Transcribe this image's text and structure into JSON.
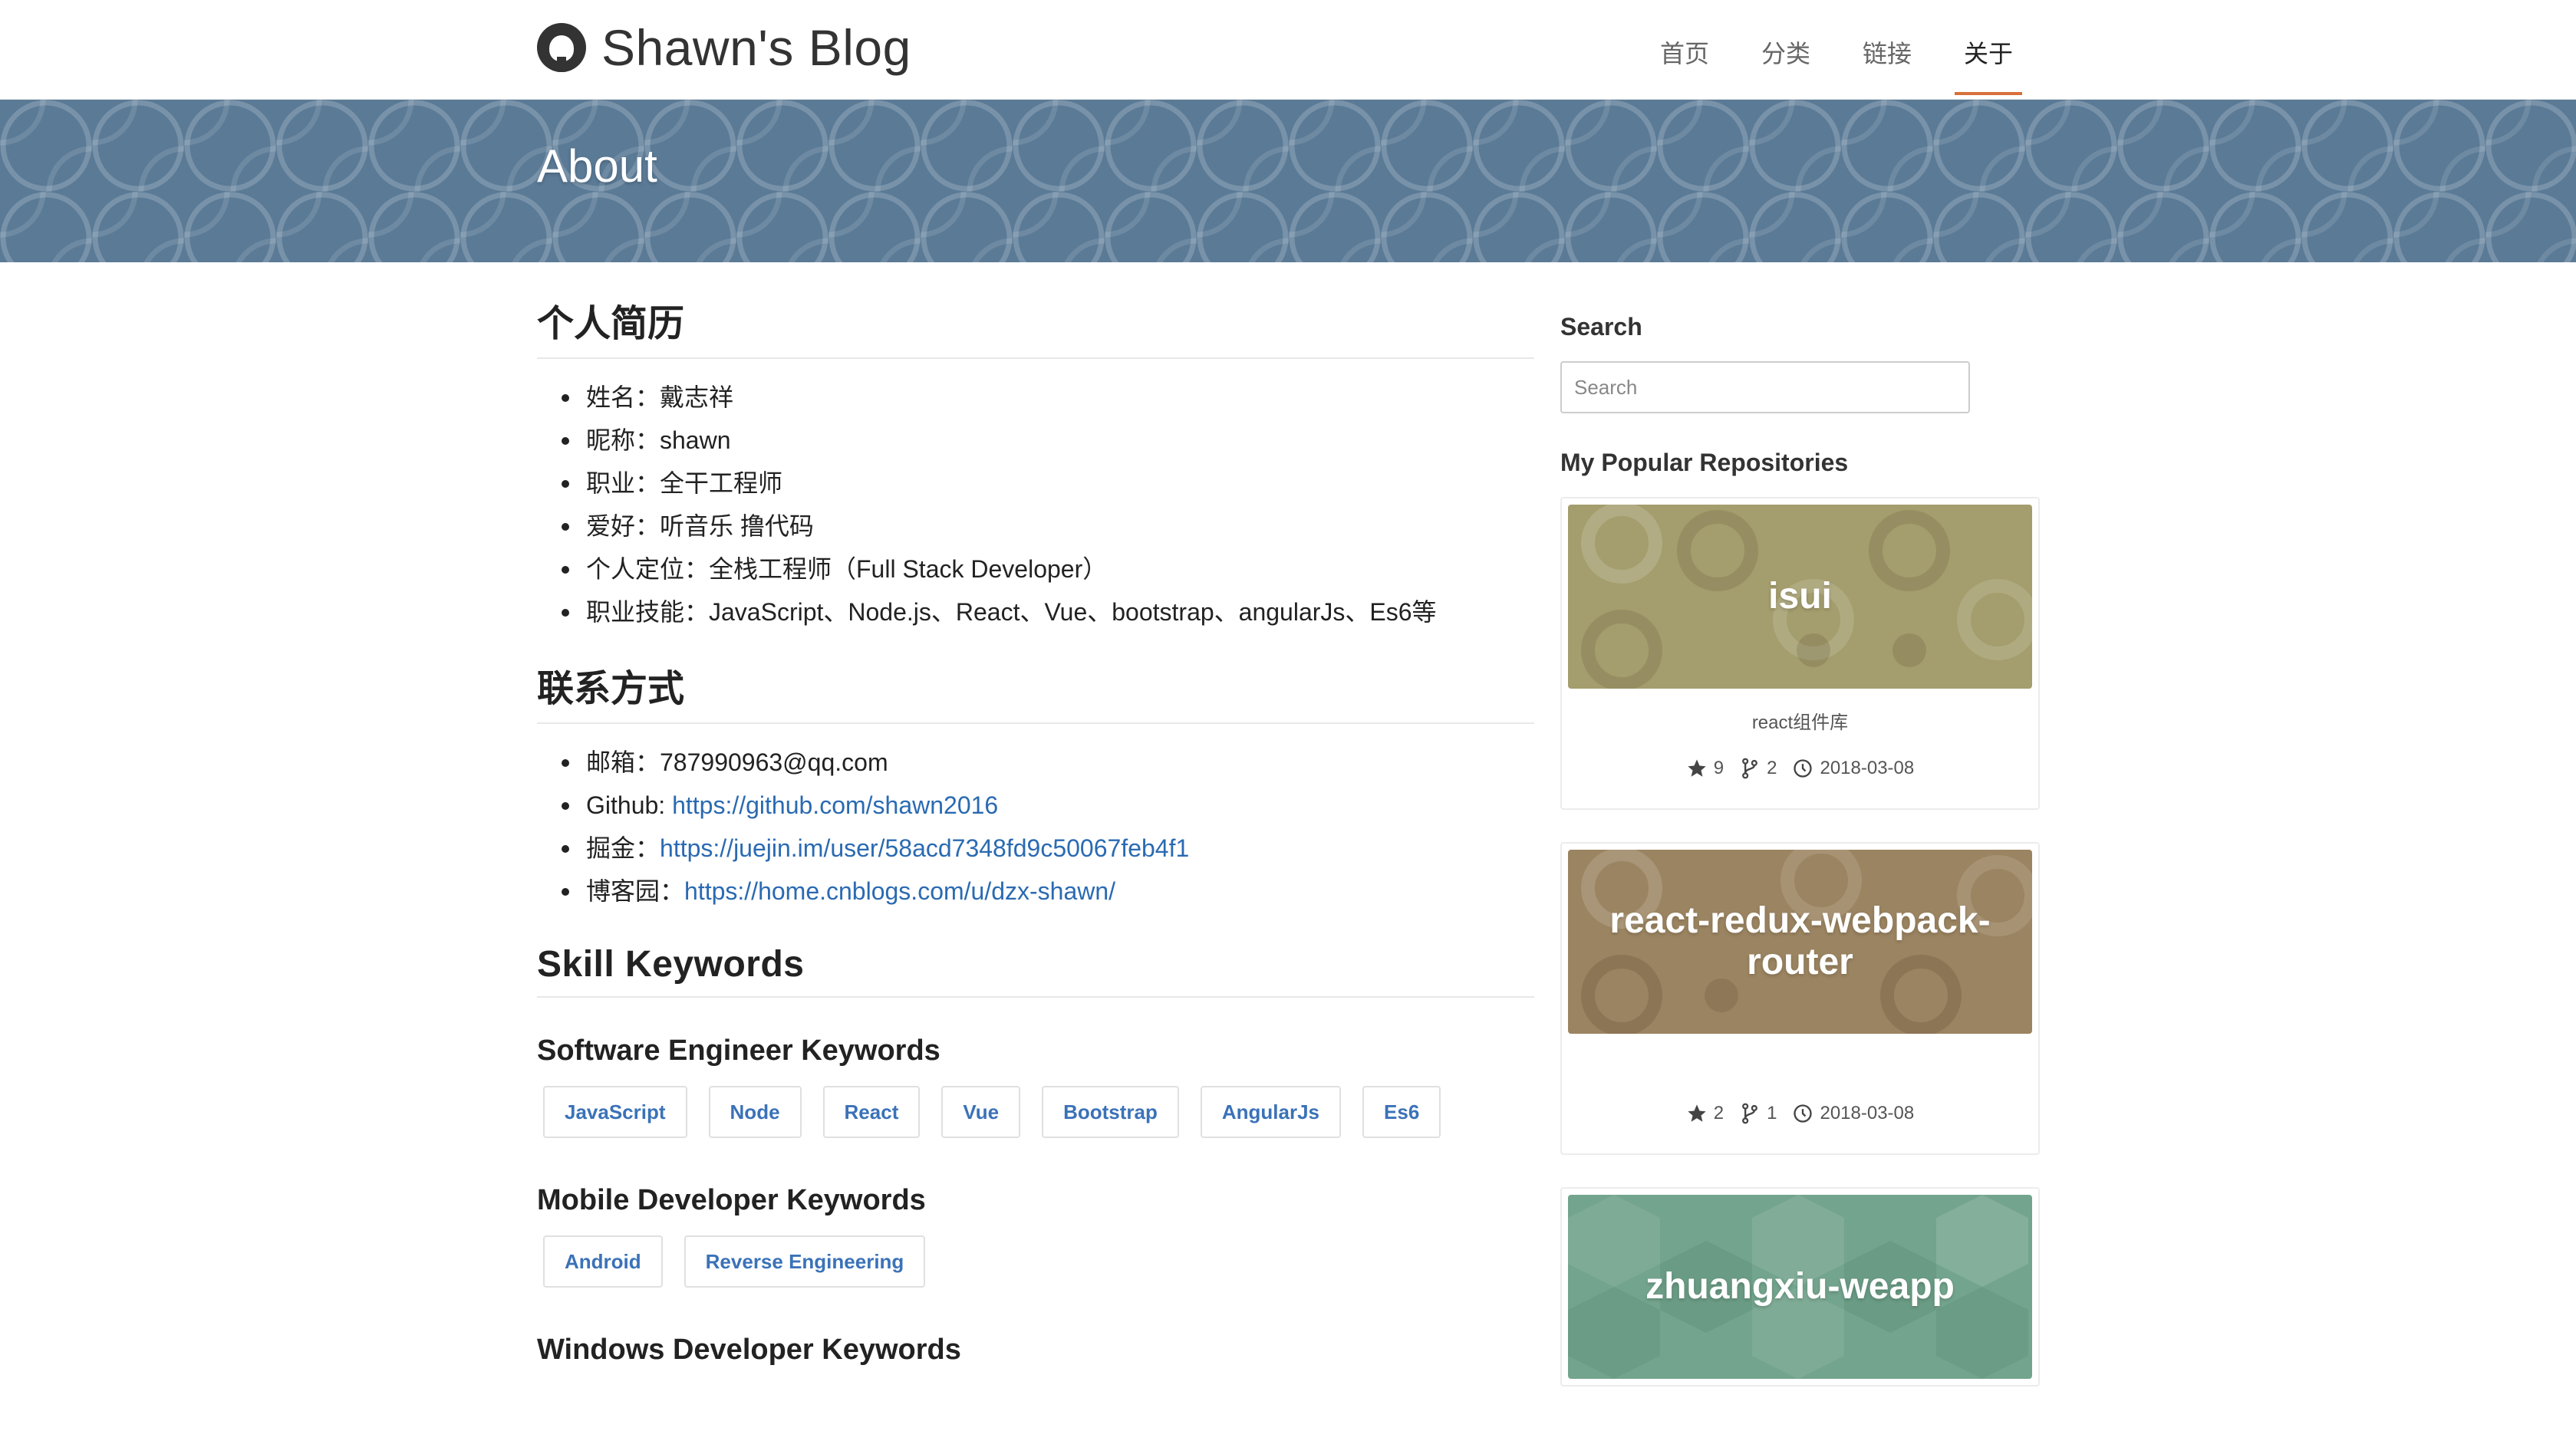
{
  "header": {
    "brand_title": "Shawn's Blog",
    "nav": [
      {
        "label": "首页"
      },
      {
        "label": "分类"
      },
      {
        "label": "链接"
      },
      {
        "label": "关于",
        "active": true
      }
    ]
  },
  "banner": {
    "title": "About"
  },
  "resume": {
    "title": "个人简历",
    "items": [
      "姓名：戴志祥",
      "昵称：shawn",
      "职业：全干工程师",
      "爱好：听音乐 撸代码",
      "个人定位：全栈工程师（Full Stack Developer）",
      "职业技能：JavaScript、Node.js、React、Vue、bootstrap、angularJs、Es6等"
    ]
  },
  "contact": {
    "title": "联系方式",
    "email": "邮箱：787990963@qq.com",
    "github_label": "Github: ",
    "github_link": "https://github.com/shawn2016",
    "juejin_label": "掘金：",
    "juejin_link": "https://juejin.im/user/58acd7348fd9c50067feb4f1",
    "cnblogs_label": "博客园：",
    "cnblogs_link": "https://home.cnblogs.com/u/dzx-shawn/"
  },
  "skills": {
    "title": "Skill Keywords",
    "software_title": "Software Engineer Keywords",
    "software_tags": [
      "JavaScript",
      "Node",
      "React",
      "Vue",
      "Bootstrap",
      "AngularJs",
      "Es6"
    ],
    "mobile_title": "Mobile Developer Keywords",
    "mobile_tags": [
      "Android",
      "Reverse Engineering"
    ],
    "windows_title": "Windows Developer Keywords"
  },
  "sidebar": {
    "search_title": "Search",
    "search_placeholder": "Search",
    "repos_title": "My Popular Repositories",
    "repos": [
      {
        "name": "isui",
        "desc": "react组件库",
        "stars": "9",
        "forks": "2",
        "date": "2018-03-08",
        "color": "#a49d6d"
      },
      {
        "name": "react-redux-webpack-router",
        "desc": "",
        "stars": "2",
        "forks": "1",
        "date": "2018-03-08",
        "color": "#9b8461"
      },
      {
        "name": "zhuangxiu-weapp",
        "desc": "",
        "stars": "",
        "forks": "",
        "date": "",
        "color": "#73a48d"
      }
    ]
  },
  "colors": {
    "accent": "#d8703a",
    "link": "#2a6ab2",
    "banner": "#5a7a96"
  }
}
